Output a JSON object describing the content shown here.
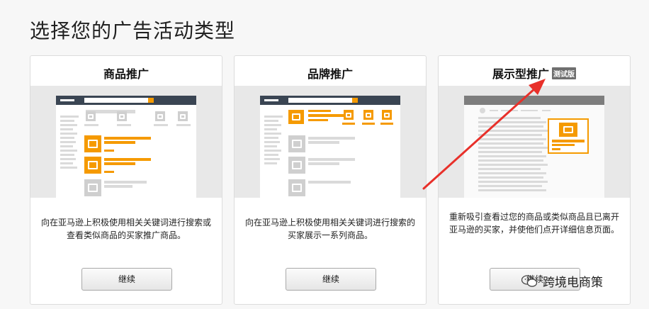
{
  "page": {
    "title": "选择您的广告活动类型"
  },
  "cards": [
    {
      "title": "商品推广",
      "description": "向在亚马逊上积极使用相关关键词进行搜索或查看类似商品的买家推广商品。",
      "button": "继续"
    },
    {
      "title": "品牌推广",
      "description": "向在亚马逊上积极使用相关关键词进行搜索的买家展示一系列商品。",
      "button": "继续"
    },
    {
      "title": "展示型推广",
      "badge": "测试版",
      "description": "重新吸引查看过您的商品或类似商品且已离开亚马逊的买家，并使他们点开详细信息页面。",
      "button": "继续"
    }
  ],
  "overlay": {
    "watermark": "跨境电商策",
    "arrow_color": "#e8302a",
    "watermark_icon": "wechat-icon"
  },
  "colors": {
    "accent": "#f59a00",
    "header_bar": "#3a4553"
  }
}
